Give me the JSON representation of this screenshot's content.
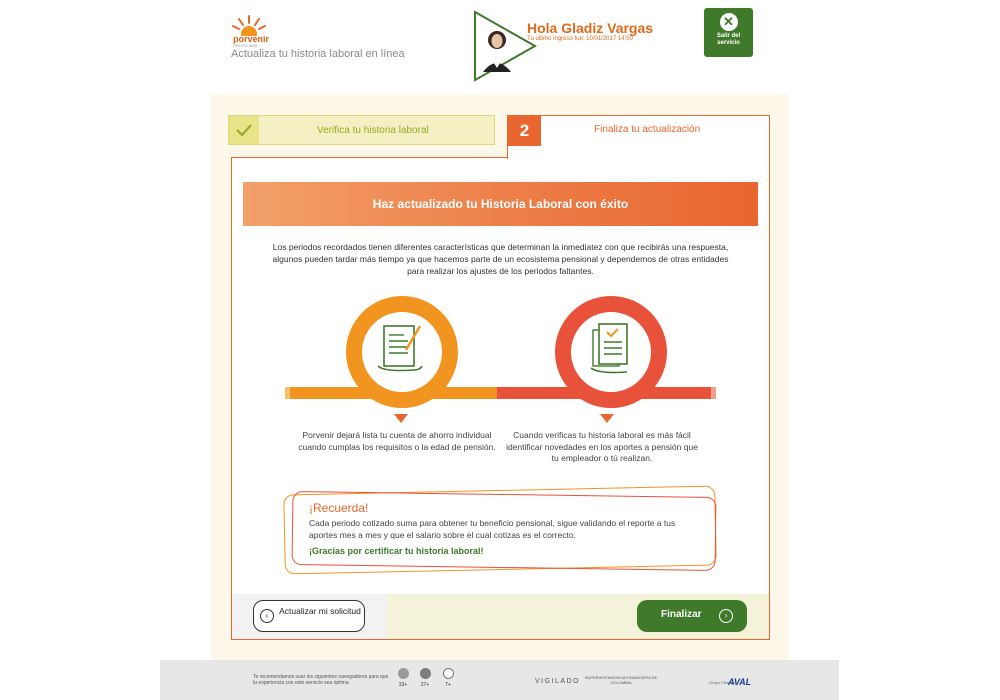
{
  "header": {
    "brand": "porvenir",
    "brand_sub": "GRUPO AVAL",
    "tagline": "Actualiza tu historia laboral en línea",
    "greeting": "Hola Gladiz Vargas",
    "last_login": "Tu último ingreso fue: 10/01/2017 14:00",
    "exit_label": "Salir del servicio",
    "exit_icon": "close-icon"
  },
  "steps": {
    "step1_label": "Verifica tu historia laboral",
    "step2_number": "2",
    "step2_label": "Finaliza tu actualización"
  },
  "main": {
    "banner": "Haz actualizado tu Historia Laboral con éxito",
    "intro": "Los periodos recordados tienen diferentes características que determinan la inmediatez con que recibirás una respuesta, algunos pueden tardar más tiempo ya que hacemos parte de un ecosistema pensional y dependemos de otras entidades para realizar los ajustes de los periodos faltantes.",
    "left_desc": "Porvenir dejará lista tu cuenta de ahorro individual cuando cumplas los requisitos o la edad de pensión.",
    "right_desc": "Cuando verificas tu historia laboral es más fácil identificar novedades en los aportes a pensión que tu empleador o tú realizan."
  },
  "reminder": {
    "title": "¡Recuerda!",
    "text": "Cada periodo cotizado suma para obtener tu beneficio pensional, sigue validando el reporte a tus aportes mes a mes y que el salario sobre el cual cotizas es el correcto.",
    "thanks": "¡Gracias por certificar tu historia laboral!"
  },
  "actions": {
    "update_label": "Actualizar mi solicitud",
    "finalize_label": "Finalizar"
  },
  "footer": {
    "recommendation": "Te recomendamos usar los siguientes navegadores para que tu experiencia con este servicio sea óptima",
    "browsers": [
      {
        "icon": "chrome-icon",
        "version": "33+"
      },
      {
        "icon": "firefox-icon",
        "version": "27+"
      },
      {
        "icon": "safari-icon",
        "version": "7+"
      }
    ],
    "vigilado": "VIGILADO",
    "superintendencia": "SUPERINTENDENCIA FINANCIERA DE COLOMBIA",
    "aval_pre": "Grupo Filial de",
    "aval": "AVAL"
  },
  "colors": {
    "orange": "#e9662e",
    "amber": "#f29520",
    "red": "#e8523a",
    "green": "#3f7a2b",
    "lime": "#8fae1c"
  }
}
